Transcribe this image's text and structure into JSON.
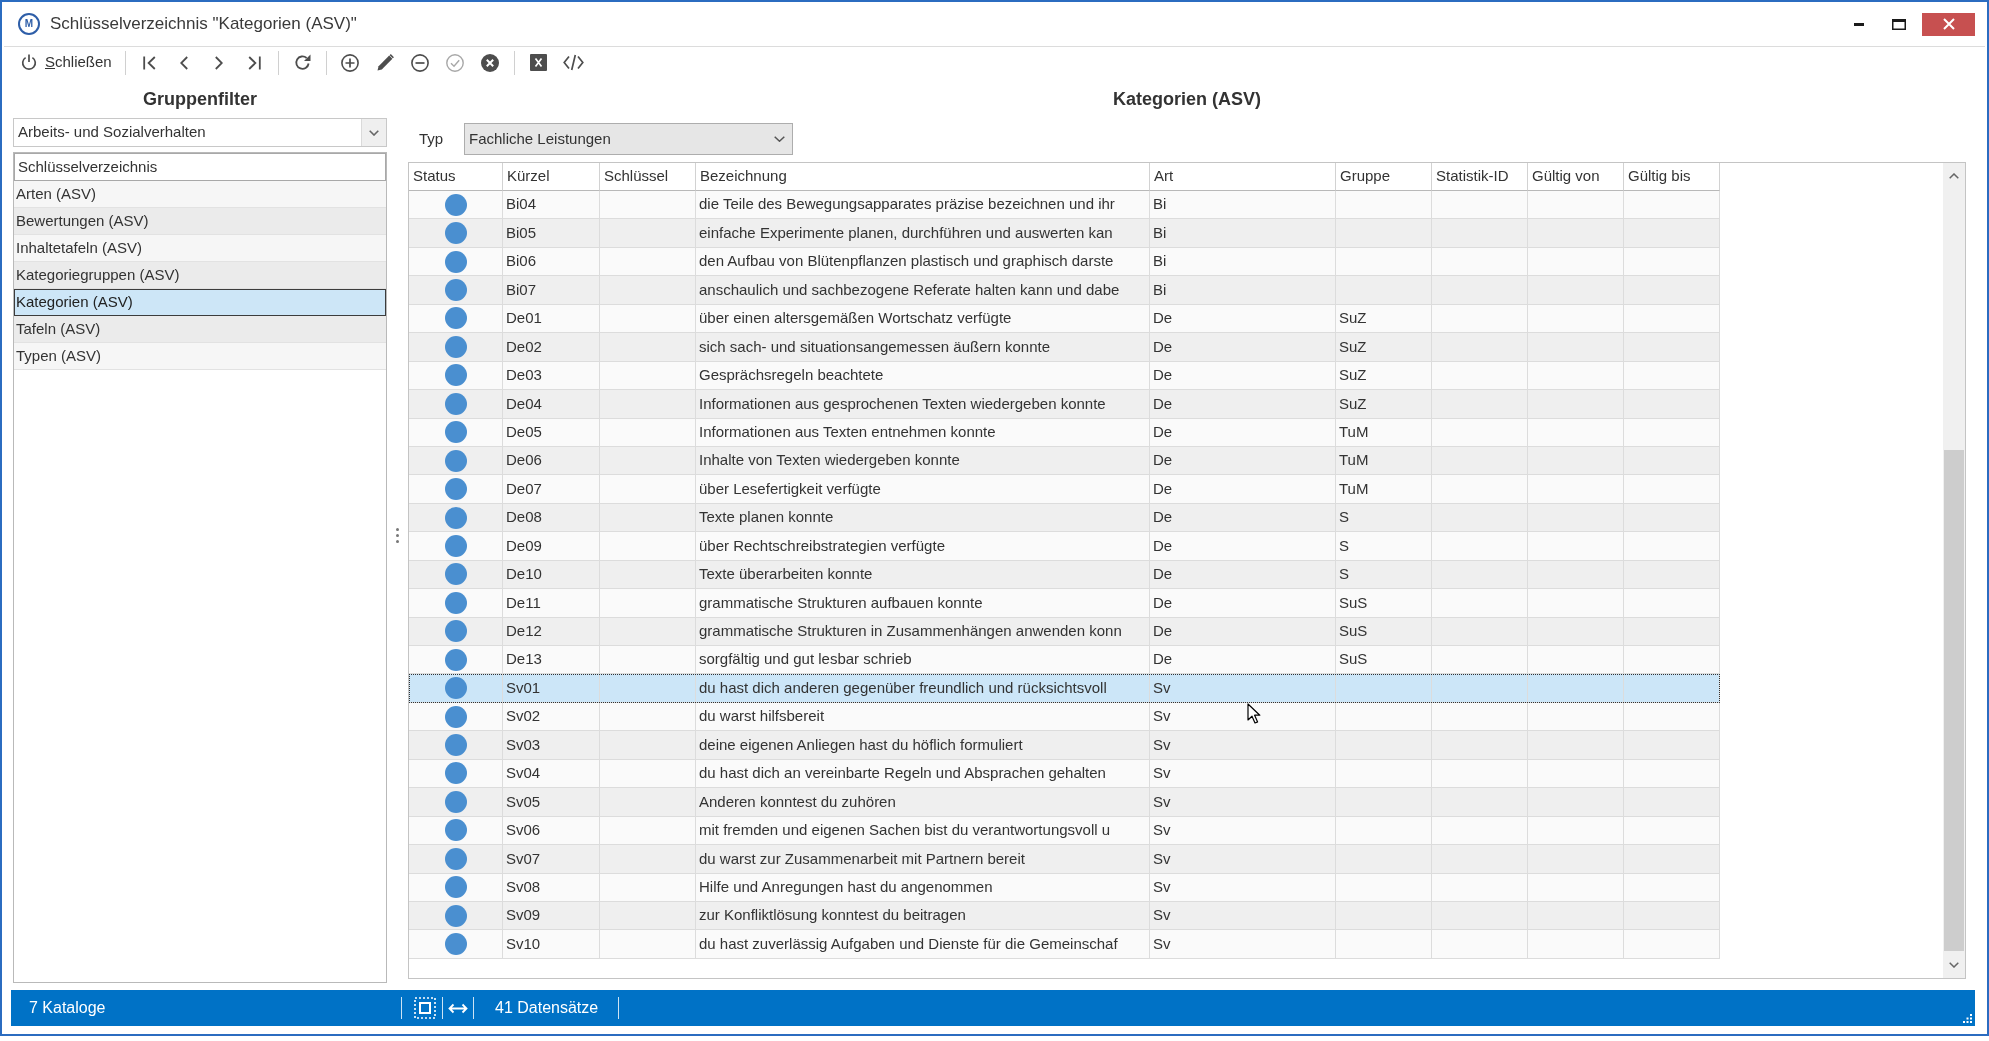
{
  "window": {
    "icon_letter": "M",
    "title": "Schlüsselverzeichnis \"Kategorien (ASV)\""
  },
  "toolbar": {
    "close_button": {
      "label": "Schließen",
      "access_key_underlined": true
    },
    "button_groups": [
      [
        {
          "disabled": false
        },
        {
          "disabled": false
        },
        {
          "disabled": false
        },
        {
          "disabled": false
        }
      ],
      [
        {
          "disabled": false
        }
      ],
      [
        {
          "disabled": false
        },
        {
          "disabled": false
        },
        {
          "disabled": false
        },
        {
          "disabled": true
        },
        {
          "disabled": false
        }
      ],
      [
        {
          "disabled": false
        },
        {
          "disabled": false
        }
      ]
    ]
  },
  "group_filter": {
    "title": "Gruppenfilter",
    "dropdown": {
      "value": "Arbeits- und Sozialverhalten"
    },
    "list": {
      "column_header": "Schlüsselverzeichnis",
      "items": [
        {
          "label": "Arten (ASV)",
          "selected": false
        },
        {
          "label": "Bewertungen (ASV)",
          "selected": false
        },
        {
          "label": "Inhaltetafeln (ASV)",
          "selected": false
        },
        {
          "label": "Kategoriegruppen (ASV)",
          "selected": false
        },
        {
          "label": "Kategorien (ASV)",
          "selected": true
        },
        {
          "label": "Tafeln (ASV)",
          "selected": false
        },
        {
          "label": "Typen (ASV)",
          "selected": false
        }
      ]
    }
  },
  "categories": {
    "title": "Kategorien (ASV)",
    "type_filter": {
      "label": "Typ",
      "value": "Fachliche Leistungen"
    },
    "table": {
      "columns": [
        "Status",
        "Kürzel",
        "Schlüssel",
        "Bezeichnung",
        "Art",
        "Gruppe",
        "Statistik-ID",
        "Gültig von",
        "Gültig bis"
      ],
      "rows": [
        {
          "color": "#4a8fd0",
          "kuerzel": "Bi04",
          "bezeichnung": "die Teile des Bewegungsapparates präzise bezeichnen und ihr",
          "art": "Bi",
          "selected": false
        },
        {
          "color": "#4a8fd0",
          "kuerzel": "Bi05",
          "bezeichnung": "einfache Experimente planen, durchführen und auswerten kan",
          "art": "Bi",
          "selected": false
        },
        {
          "color": "#4a8fd0",
          "kuerzel": "Bi06",
          "bezeichnung": "den Aufbau von Blütenpflanzen plastisch und graphisch darste",
          "art": "Bi",
          "selected": false
        },
        {
          "color": "#4a8fd0",
          "kuerzel": "Bi07",
          "bezeichnung": "anschaulich und sachbezogene Referate halten kann und dabe",
          "art": "Bi",
          "selected": false
        },
        {
          "color": "#4a8fd0",
          "kuerzel": "De01",
          "bezeichnung": "über einen altersgemäßen Wortschatz verfügte",
          "art": "De",
          "gruppe": "SuZ",
          "selected": false
        },
        {
          "color": "#4a8fd0",
          "kuerzel": "De02",
          "bezeichnung": "sich sach- und situationsangemessen äußern konnte",
          "art": "De",
          "gruppe": "SuZ",
          "selected": false
        },
        {
          "color": "#4a8fd0",
          "kuerzel": "De03",
          "bezeichnung": "Gesprächsregeln beachtete",
          "art": "De",
          "gruppe": "SuZ",
          "selected": false
        },
        {
          "color": "#4a8fd0",
          "kuerzel": "De04",
          "bezeichnung": "Informationen aus gesprochenen Texten wiedergeben konnte",
          "art": "De",
          "gruppe": "SuZ",
          "selected": false
        },
        {
          "color": "#4a8fd0",
          "kuerzel": "De05",
          "bezeichnung": "Informationen aus Texten entnehmen konnte",
          "art": "De",
          "gruppe": "TuM",
          "selected": false
        },
        {
          "color": "#4a8fd0",
          "kuerzel": "De06",
          "bezeichnung": "Inhalte von Texten wiedergeben konnte",
          "art": "De",
          "gruppe": "TuM",
          "selected": false
        },
        {
          "color": "#4a8fd0",
          "kuerzel": "De07",
          "bezeichnung": "über Lesefertigkeit verfügte",
          "art": "De",
          "gruppe": "TuM",
          "selected": false
        },
        {
          "color": "#4a8fd0",
          "kuerzel": "De08",
          "bezeichnung": "Texte planen konnte",
          "art": "De",
          "gruppe": "S",
          "selected": false
        },
        {
          "color": "#4a8fd0",
          "kuerzel": "De09",
          "bezeichnung": "über Rechtschreibstrategien verfügte",
          "art": "De",
          "gruppe": "S",
          "selected": false
        },
        {
          "color": "#4a8fd0",
          "kuerzel": "De10",
          "bezeichnung": "Texte überarbeiten konnte",
          "art": "De",
          "gruppe": "S",
          "selected": false
        },
        {
          "color": "#4a8fd0",
          "kuerzel": "De11",
          "bezeichnung": "grammatische Strukturen aufbauen konnte",
          "art": "De",
          "gruppe": "SuS",
          "selected": false
        },
        {
          "color": "#4a8fd0",
          "kuerzel": "De12",
          "bezeichnung": "grammatische Strukturen in Zusammenhängen anwenden konn",
          "art": "De",
          "gruppe": "SuS",
          "selected": false
        },
        {
          "color": "#4a8fd0",
          "kuerzel": "De13",
          "bezeichnung": "sorgfältig und gut lesbar schrieb",
          "art": "De",
          "gruppe": "SuS",
          "selected": false
        },
        {
          "color": "#4a8fd0",
          "kuerzel": "Sv01",
          "bezeichnung": "du hast dich anderen gegenüber freundlich und rücksichtsvoll",
          "art": "Sv",
          "selected": true
        },
        {
          "color": "#4a8fd0",
          "kuerzel": "Sv02",
          "bezeichnung": "du warst hilfsbereit",
          "art": "Sv",
          "selected": false
        },
        {
          "color": "#4a8fd0",
          "kuerzel": "Sv03",
          "bezeichnung": "deine eigenen Anliegen hast du höflich formuliert",
          "art": "Sv",
          "selected": false
        },
        {
          "color": "#4a8fd0",
          "kuerzel": "Sv04",
          "bezeichnung": "du hast dich an vereinbarte Regeln und Absprachen gehalten",
          "art": "Sv",
          "selected": false
        },
        {
          "color": "#4a8fd0",
          "kuerzel": "Sv05",
          "bezeichnung": "Anderen konntest du zuhören",
          "art": "Sv",
          "selected": false
        },
        {
          "color": "#4a8fd0",
          "kuerzel": "Sv06",
          "bezeichnung": "mit fremden und eigenen Sachen bist du verantwortungsvoll u",
          "art": "Sv",
          "selected": false
        },
        {
          "color": "#4a8fd0",
          "kuerzel": "Sv07",
          "bezeichnung": "du warst zur Zusammenarbeit mit Partnern bereit",
          "art": "Sv",
          "selected": false
        },
        {
          "color": "#4a8fd0",
          "kuerzel": "Sv08",
          "bezeichnung": "Hilfe und Anregungen hast du angenommen",
          "art": "Sv",
          "selected": false
        },
        {
          "color": "#4a8fd0",
          "kuerzel": "Sv09",
          "bezeichnung": "zur Konfliktlösung konntest du beitragen",
          "art": "Sv",
          "selected": false
        },
        {
          "color": "#4a8fd0",
          "kuerzel": "Sv10",
          "bezeichnung": "du hast zuverlässig Aufgaben und Dienste für die Gemeinschaf",
          "art": "Sv",
          "selected": false
        }
      ]
    }
  },
  "status_bar": {
    "catalog_count": "7 Kataloge",
    "record_count": "41 Datensätze"
  }
}
